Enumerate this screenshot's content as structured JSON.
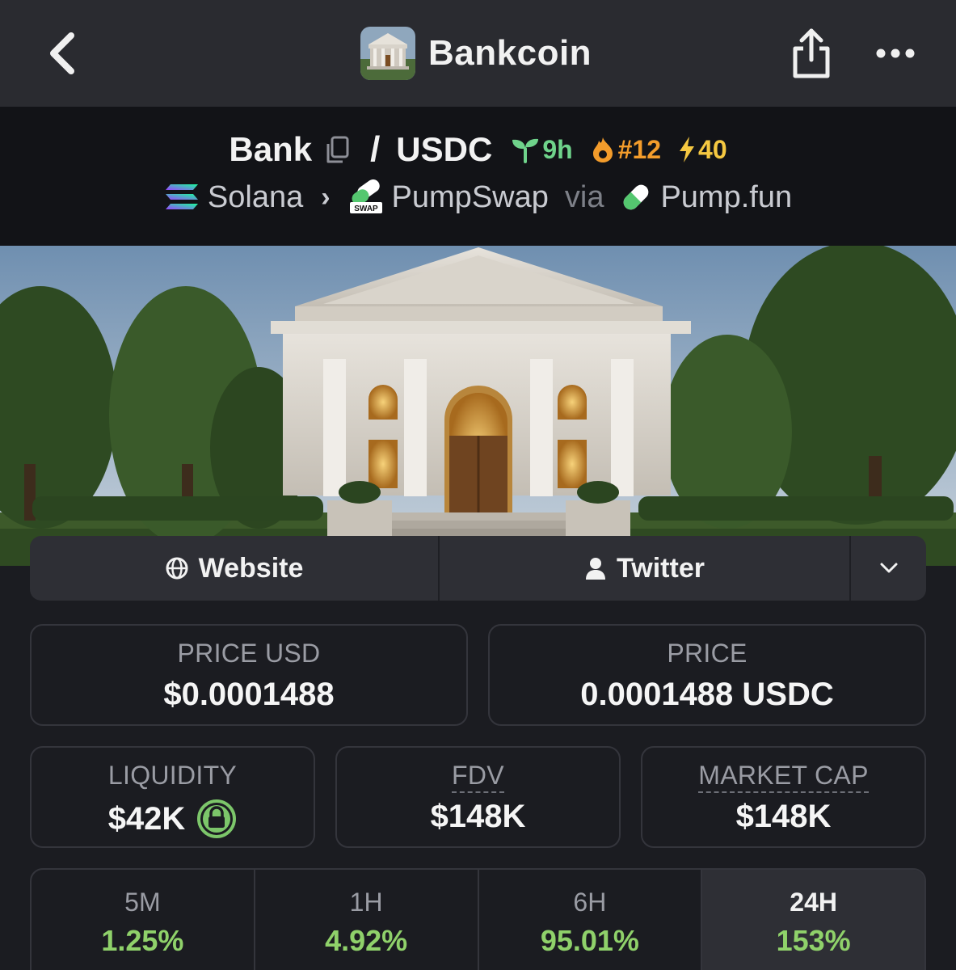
{
  "header": {
    "title": "Bankcoin",
    "logo_icon": "bank-building-logo"
  },
  "pair": {
    "base": "Bank",
    "separator": "/",
    "quote": "USDC",
    "age": "9h",
    "rank": "#12",
    "boosts": "40",
    "chain": "Solana",
    "dex": "PumpSwap",
    "via_label": "via",
    "launchpad": "Pump.fun",
    "colors": {
      "age": "#6fd38b",
      "rank": "#f39c2b",
      "boost": "#f5c841"
    }
  },
  "links": {
    "website": "Website",
    "twitter": "Twitter"
  },
  "stats": {
    "price_usd_label": "PRICE USD",
    "price_usd": "$0.0001488",
    "price_label": "PRICE",
    "price": "0.0001488 USDC",
    "liquidity_label": "LIQUIDITY",
    "liquidity": "$42K",
    "fdv_label": "FDV",
    "fdv": "$148K",
    "mcap_label": "MARKET CAP",
    "mcap": "$148K"
  },
  "changes": [
    {
      "label": "5M",
      "value": "1.25%"
    },
    {
      "label": "1H",
      "value": "4.92%"
    },
    {
      "label": "6H",
      "value": "95.01%"
    },
    {
      "label": "24H",
      "value": "153%"
    }
  ],
  "accent_positive": "#8fd16a"
}
